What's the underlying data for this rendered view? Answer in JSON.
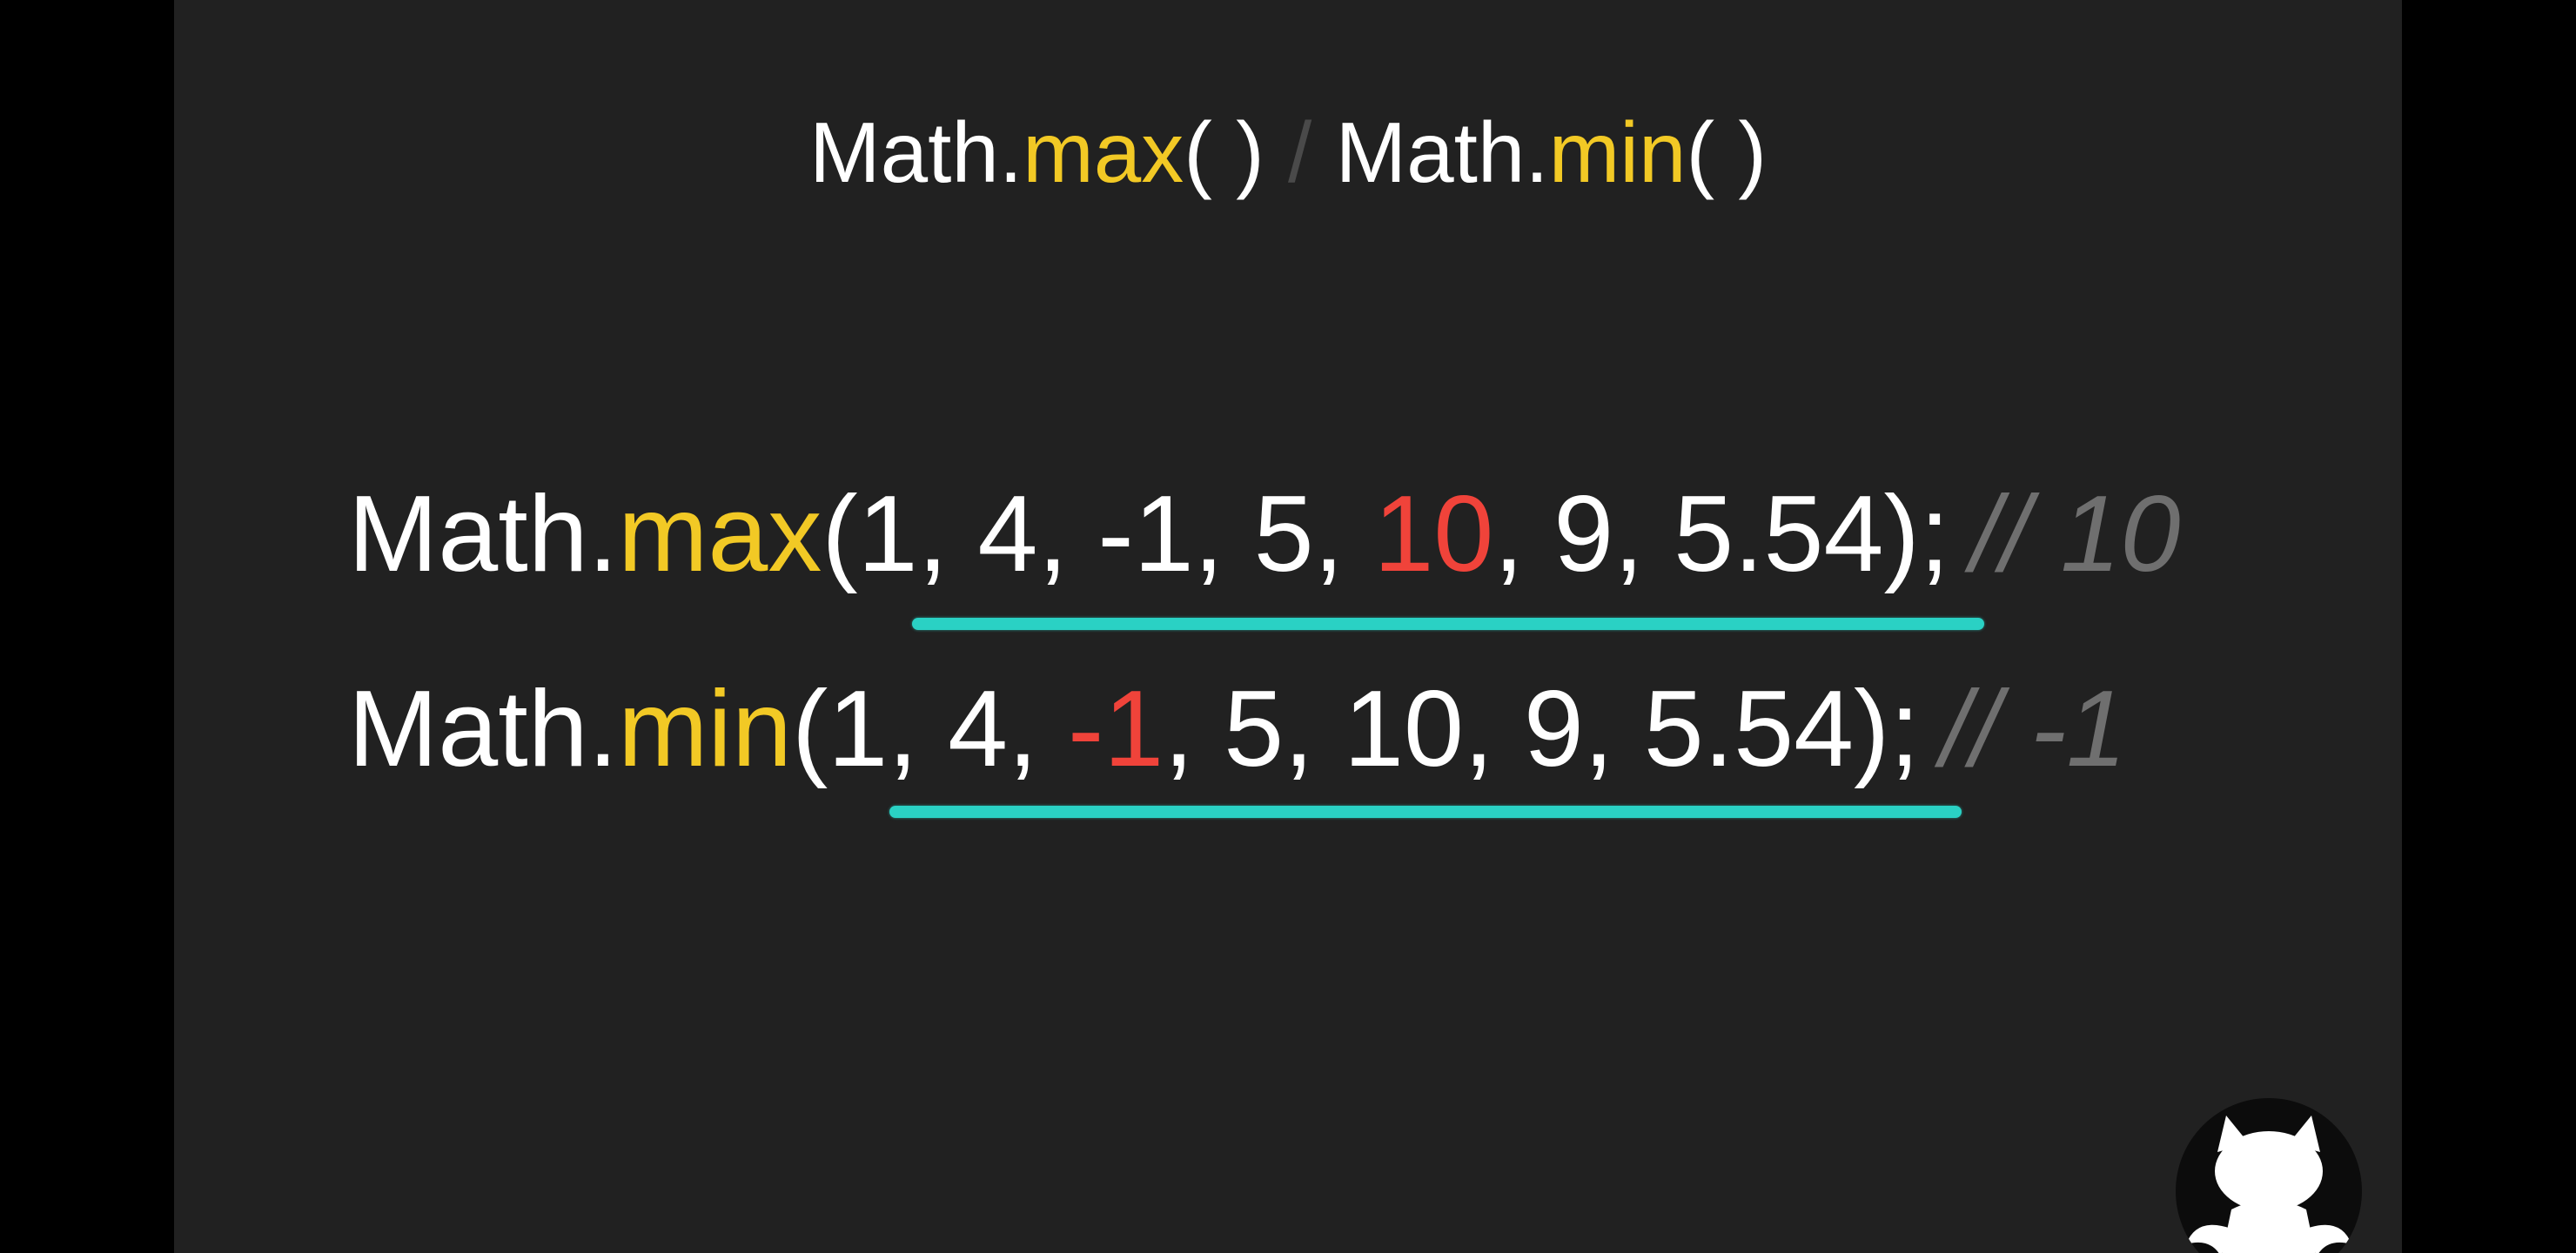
{
  "title": {
    "prefix1": "Math.",
    "method1": "max",
    "parens1": "( )",
    "separator": "/",
    "prefix2": "Math.",
    "method2": "min",
    "parens2": "( )"
  },
  "line_max": {
    "prefix": "Math.",
    "method": "max",
    "args_before": "(1, 4, -1, 5, ",
    "highlight": "10",
    "args_after": ", 9, 5.54);",
    "comment": "// 10"
  },
  "line_min": {
    "prefix": "Math.",
    "method": "min",
    "args_before": "(1, 4, ",
    "highlight": "-1",
    "args_after": ", 5, 10, 9, 5.54);",
    "comment": "// -1"
  },
  "colors": {
    "background": "#212121",
    "method": "#f2c925",
    "highlight": "#f0433a",
    "underline": "#2ad1c4",
    "comment": "#6f6f6f"
  },
  "icons": {
    "mascot": "devil-cat-mascot-icon"
  }
}
